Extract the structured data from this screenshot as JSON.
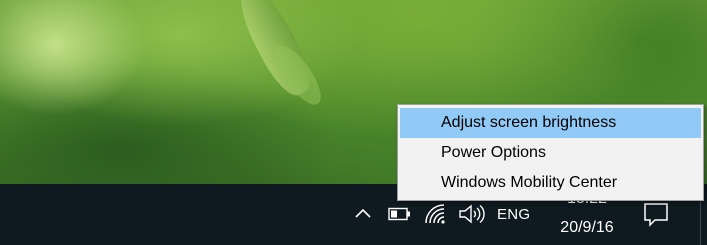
{
  "context_menu": {
    "items": [
      {
        "label": "Adjust screen brightness",
        "highlighted": true
      },
      {
        "label": "Power Options",
        "highlighted": false
      },
      {
        "label": "Windows Mobility Center",
        "highlighted": false
      }
    ],
    "highlight_color": "#91c9f7"
  },
  "taskbar": {
    "language": "ENG",
    "time": "18:22",
    "date": "20/9/16",
    "icons": [
      "show-hidden-icons-chevron-icon",
      "battery-icon",
      "wifi-icon",
      "volume-icon",
      "notifications-icon"
    ],
    "background_color": "#0e1a20"
  }
}
